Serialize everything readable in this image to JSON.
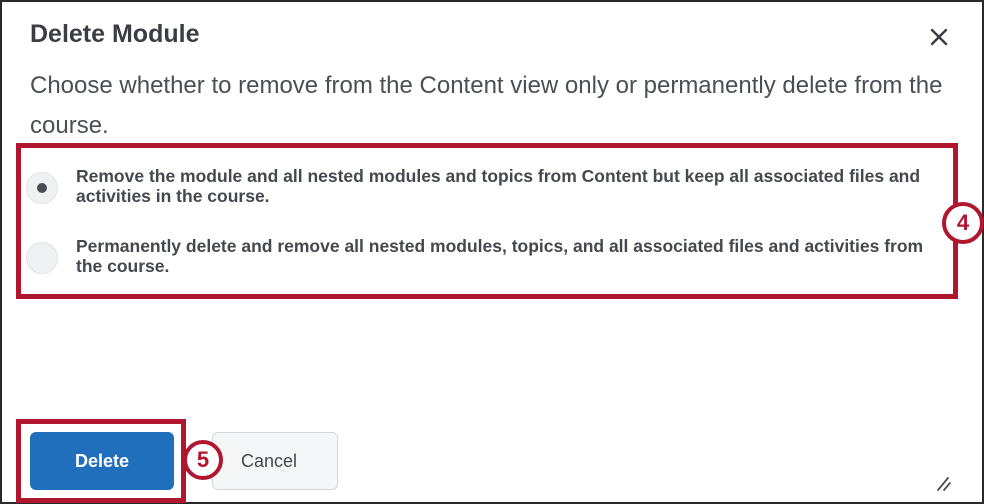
{
  "dialog": {
    "title": "Delete Module",
    "close_icon": "close-icon",
    "description": "Choose whether to remove from the Content view only or permanently delete from the course.",
    "options": [
      {
        "label": "Remove the module and all nested modules and topics from Content but keep all associated files and activities in the course.",
        "selected": true
      },
      {
        "label": "Permanently delete and remove all nested modules, topics, and all associated files and activities from the course.",
        "selected": false
      }
    ],
    "buttons": {
      "delete_label": "Delete",
      "cancel_label": "Cancel"
    }
  },
  "annotations": {
    "step_options": "4",
    "step_delete": "5",
    "highlight_color": "#b0172f"
  },
  "colors": {
    "primary_button": "#1f6fbd",
    "text": "#45484e"
  }
}
